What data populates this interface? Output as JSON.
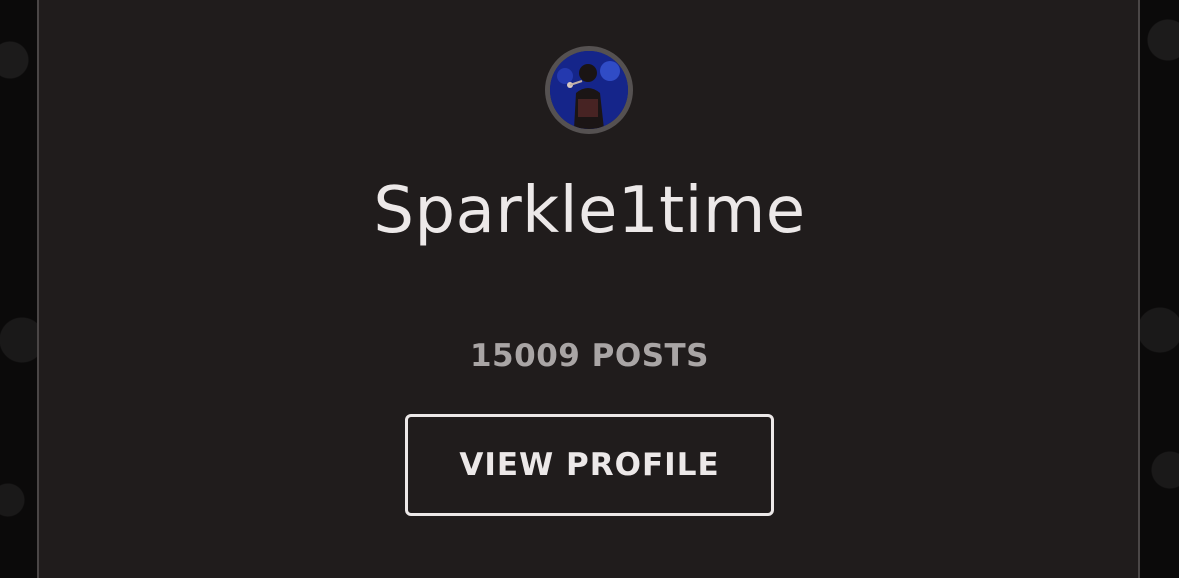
{
  "profile": {
    "username": "Sparkle1time",
    "post_count_label": "15009 POSTS",
    "view_profile_label": "VIEW PROFILE"
  },
  "colors": {
    "card_background": "#201c1c",
    "page_background": "#0b0a0a",
    "text_primary": "#ece8e8",
    "text_muted": "#a9a5a5",
    "avatar_ring": "#555151"
  },
  "icons": {
    "avatar": "user-avatar-photo"
  }
}
